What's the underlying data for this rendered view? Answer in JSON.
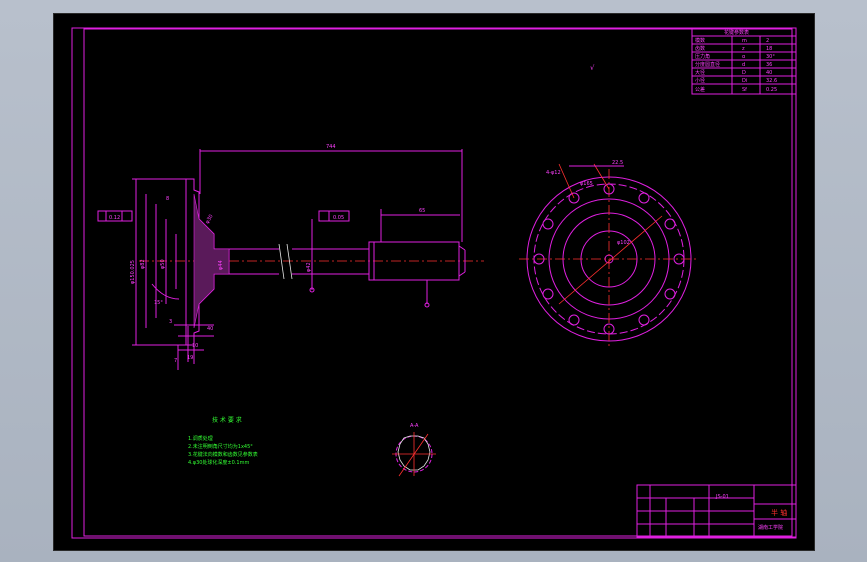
{
  "drawing": {
    "roughness": "√",
    "length_dim": "744",
    "thread_dim": "65",
    "tol_left": "0.12",
    "tol_mid": "0.05",
    "angle": "15°",
    "dia_labels": [
      "φ150.025",
      "φ82",
      "φ50",
      "φ44",
      "φ42",
      "φ30"
    ],
    "small_dims": [
      "8",
      "3",
      "10",
      "19",
      "7",
      "40"
    ],
    "flange_dims": [
      "φ102",
      "φ165",
      "4-φ12",
      "22.5"
    ],
    "section_label": "A-A",
    "notes_title": "技 术 要 求",
    "notes": [
      "1.调质处理",
      "2.未注明倒角尺寸均为1x45°",
      "3.花键法向模数和齿数见参数表",
      "4.φ30处球化深度±0.1mm"
    ]
  },
  "param_table": {
    "title": "花键参数表",
    "rows": [
      [
        "模数",
        "m",
        "2"
      ],
      [
        "齿数",
        "z",
        "18"
      ],
      [
        "压力角",
        "α",
        "30°"
      ],
      [
        "分度圆直径",
        "d",
        "36"
      ],
      [
        "大径",
        "D",
        "40"
      ],
      [
        "小径",
        "Di",
        "32.6"
      ],
      [
        "公差",
        "Sf",
        "0.25"
      ]
    ]
  },
  "title_block": {
    "part_name": "半 轴",
    "drawing_no": "JS-01",
    "school": "湖南工学院"
  }
}
